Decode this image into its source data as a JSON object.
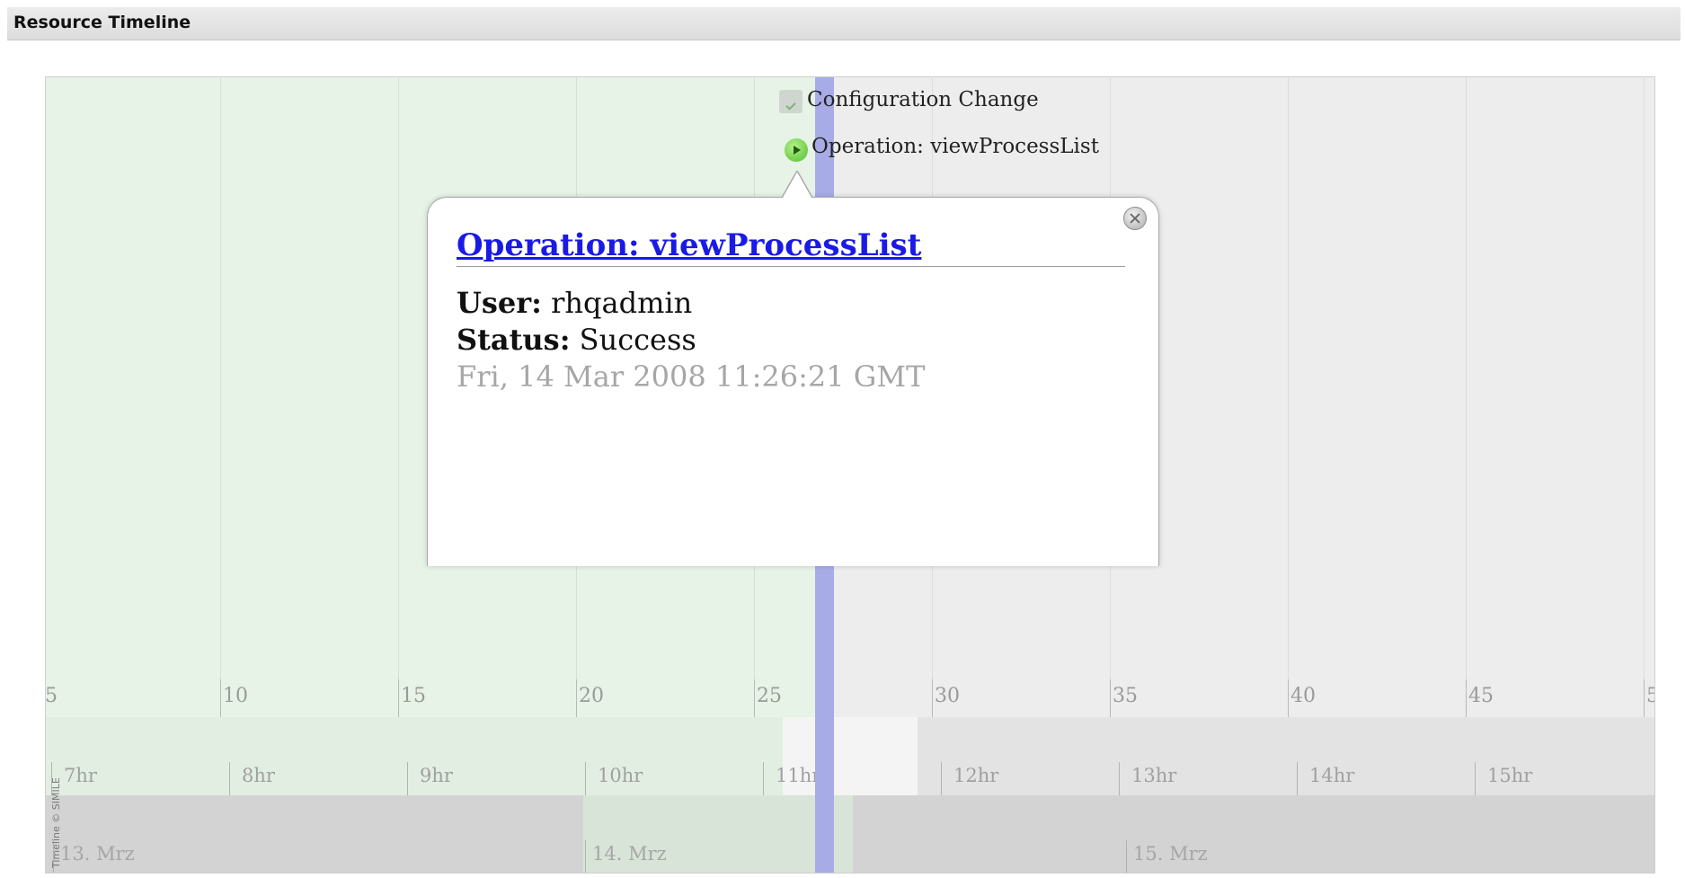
{
  "panel": {
    "title": "Resource Timeline"
  },
  "timeline": {
    "main_ticks": [
      "5",
      "10",
      "15",
      "20",
      "25",
      "30",
      "35",
      "40",
      "45",
      "5"
    ],
    "hour_labels": [
      "7hr",
      "8hr",
      "9hr",
      "10hr",
      "11hr",
      "12hr",
      "13hr",
      "14hr",
      "15hr"
    ],
    "day_labels": [
      "13. Mrz",
      "14. Mrz",
      "15. Mrz"
    ],
    "credit": "Timeline © SIMILE"
  },
  "events": [
    {
      "label": "Configuration Change",
      "icon": "configuration-change-icon"
    },
    {
      "label": "Operation: viewProcessList",
      "icon": "operation-play-icon"
    }
  ],
  "popup": {
    "title": "Operation: viewProcessList",
    "user_label": "User:",
    "user_value": "rhqadmin",
    "status_label": "Status:",
    "status_value": "Success",
    "date": "Fri, 14 Mar 2008 11:26:21 GMT"
  },
  "colors": {
    "highlight": "#e6f3e6",
    "now_marker": "#a7ace7",
    "link": "#1a1ae6"
  }
}
